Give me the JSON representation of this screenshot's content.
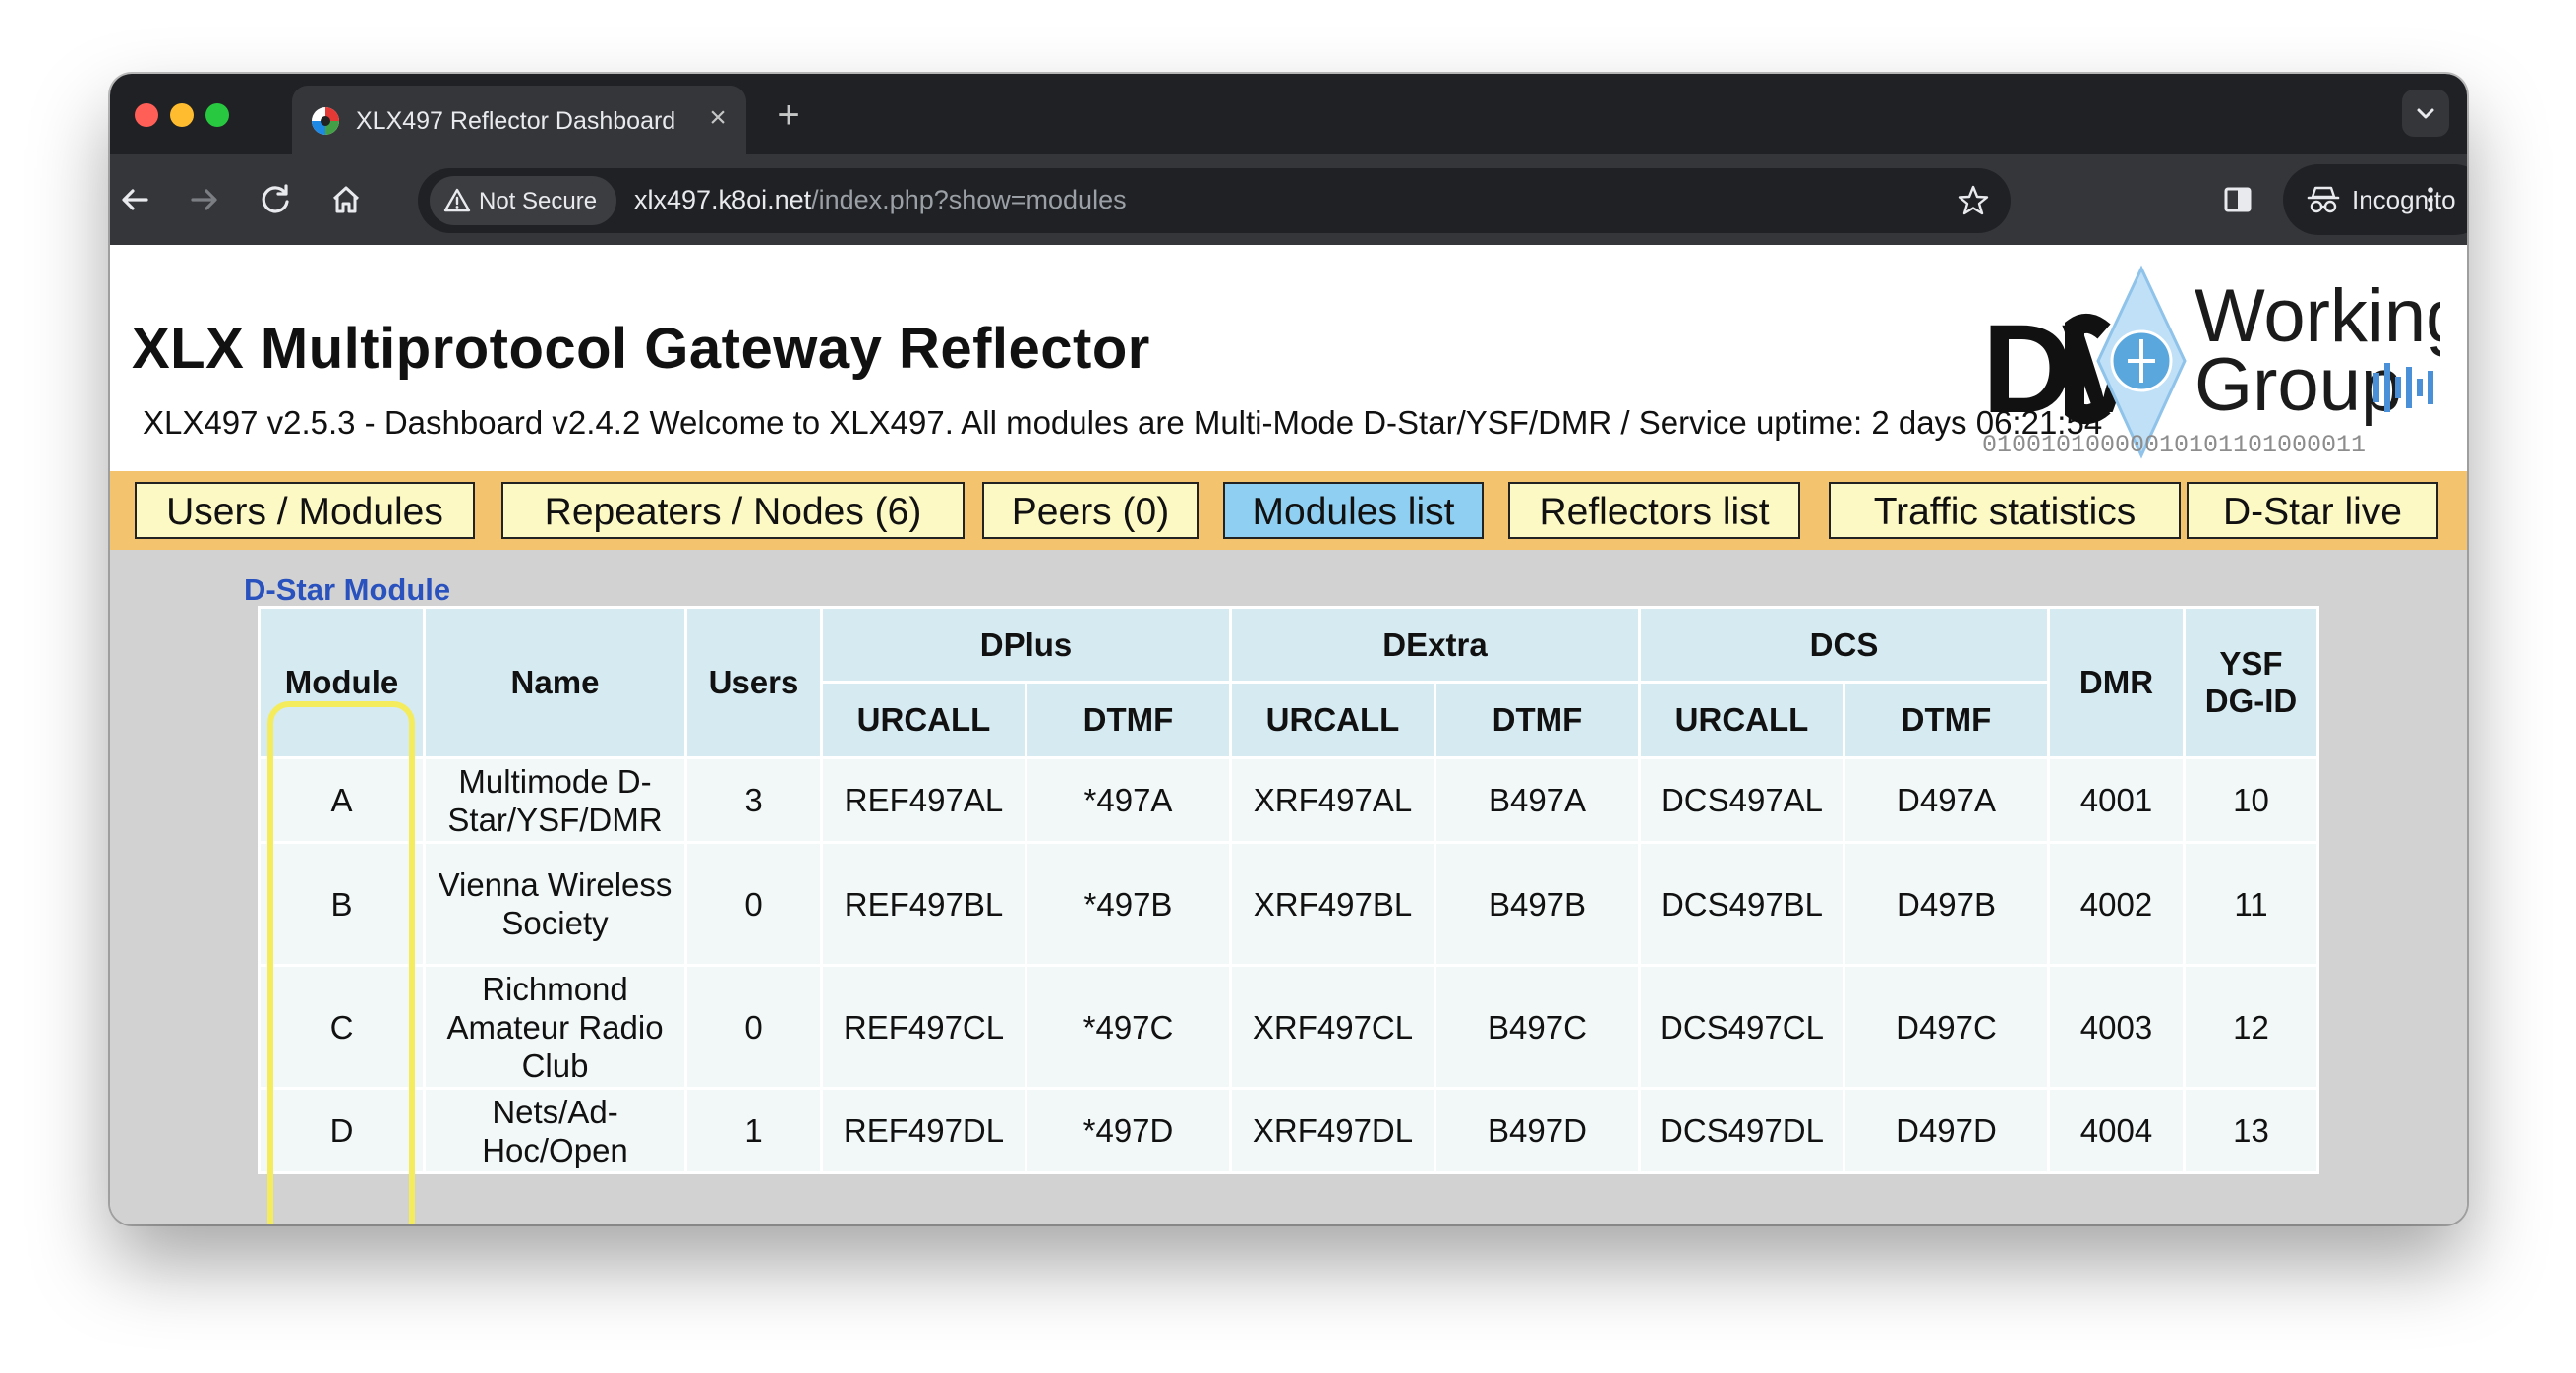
{
  "browser": {
    "tab_title": "XLX497 Reflector Dashboard",
    "tab_close": "×",
    "new_tab": "+",
    "security_label": "Not Secure",
    "url_host": "xlx497.k8oi.net",
    "url_path": "/index.php?show=modules",
    "incognito_label": "Incognito"
  },
  "header": {
    "title": "XLX Multiprotocol Gateway Reflector",
    "subtitle": "XLX497 v2.5.3 - Dashboard v2.4.2 Welcome to XLX497. All modules are Multi-Mode D-Star/YSF/DMR  /  Service uptime: 2 days 06:21:54",
    "logo_text_1": "Working",
    "logo_text_2": "Group",
    "logo_binary": "01001010000010101101000011"
  },
  "nav": {
    "users_modules": "Users / Modules",
    "repeaters_nodes": "Repeaters / Nodes (6)",
    "peers": "Peers (0)",
    "modules_list": "Modules list",
    "reflectors_list": "Reflectors list",
    "traffic_statistics": "Traffic statistics",
    "dstar_live": "D-Star live"
  },
  "section": {
    "title": "D-Star Module"
  },
  "table": {
    "headers": {
      "module": "Module",
      "name": "Name",
      "users": "Users",
      "dplus": "DPlus",
      "dextra": "DExtra",
      "dcs": "DCS",
      "dmr": "DMR",
      "ysf": "YSF DG-ID",
      "urcall": "URCALL",
      "dtmf": "DTMF"
    },
    "rows": [
      {
        "module": "A",
        "name": "Multimode D-Star/YSF/DMR",
        "users": "3",
        "dplus_urcall": "REF497AL",
        "dplus_dtmf": "*497A",
        "dextra_urcall": "XRF497AL",
        "dextra_dtmf": "B497A",
        "dcs_urcall": "DCS497AL",
        "dcs_dtmf": "D497A",
        "dmr": "4001",
        "ysf": "10"
      },
      {
        "module": "B",
        "name": "Vienna Wireless Society",
        "users": "0",
        "dplus_urcall": "REF497BL",
        "dplus_dtmf": "*497B",
        "dextra_urcall": "XRF497BL",
        "dextra_dtmf": "B497B",
        "dcs_urcall": "DCS497BL",
        "dcs_dtmf": "D497B",
        "dmr": "4002",
        "ysf": "11"
      },
      {
        "module": "C",
        "name": "Richmond Amateur Radio Club",
        "users": "0",
        "dplus_urcall": "REF497CL",
        "dplus_dtmf": "*497C",
        "dextra_urcall": "XRF497CL",
        "dextra_dtmf": "B497C",
        "dcs_urcall": "DCS497CL",
        "dcs_dtmf": "D497C",
        "dmr": "4003",
        "ysf": "12"
      },
      {
        "module": "D",
        "name": "Nets/Ad-Hoc/Open",
        "users": "1",
        "dplus_urcall": "REF497DL",
        "dplus_dtmf": "*497D",
        "dextra_urcall": "XRF497DL",
        "dextra_dtmf": "B497D",
        "dcs_urcall": "DCS497DL",
        "dcs_dtmf": "D497D",
        "dmr": "4004",
        "ysf": "13"
      }
    ]
  },
  "colors": {
    "nav_bar": "#f3c36d",
    "nav_button": "#fdf9c4",
    "nav_active": "#8fd0f2",
    "table_header": "#d6eaf2",
    "table_cell": "#f2f8f8",
    "section_title": "#2a52be",
    "highlight": "#f4ec5c"
  },
  "icons": {
    "back": "arrow-left-icon",
    "forward": "arrow-right-icon",
    "reload": "reload-icon",
    "home": "home-icon",
    "warning": "warning-triangle-icon",
    "bookmark": "star-icon",
    "sidepanel": "side-panel-icon",
    "incognito": "incognito-icon",
    "menu": "kebab-menu-icon"
  }
}
